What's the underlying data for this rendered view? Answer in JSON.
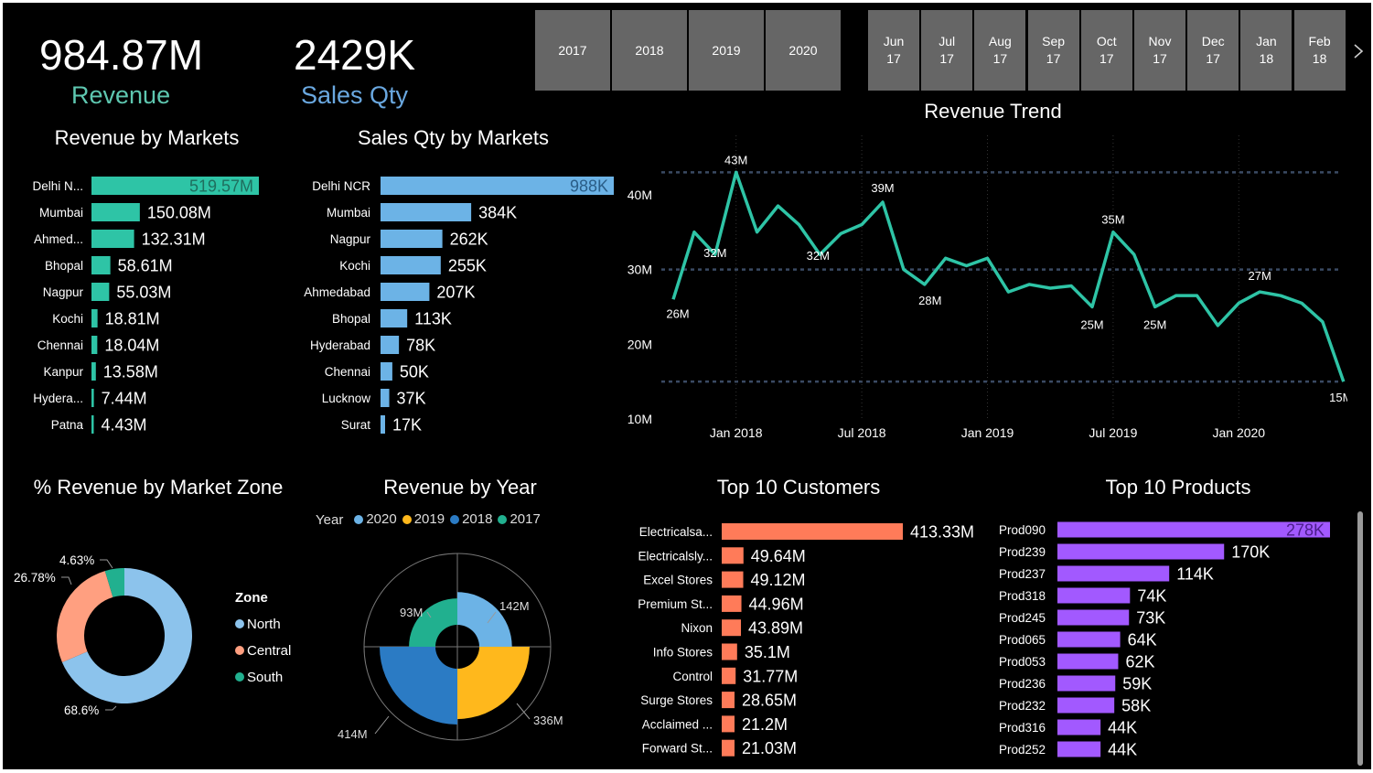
{
  "kpis": {
    "revenue": {
      "value": "984.87M",
      "label": "Revenue",
      "color": "#5ec7b0"
    },
    "sales_qty": {
      "value": "2429K",
      "label": "Sales Qty",
      "color": "#6aa8e0"
    }
  },
  "year_slicer": [
    "2017",
    "2018",
    "2019",
    "2020"
  ],
  "month_slicer": [
    {
      "m": "Jun",
      "y": "17"
    },
    {
      "m": "Jul",
      "y": "17"
    },
    {
      "m": "Aug",
      "y": "17"
    },
    {
      "m": "Sep",
      "y": "17"
    },
    {
      "m": "Oct",
      "y": "17"
    },
    {
      "m": "Nov",
      "y": "17"
    },
    {
      "m": "Dec",
      "y": "17"
    },
    {
      "m": "Jan",
      "y": "18"
    },
    {
      "m": "Feb",
      "y": "18"
    }
  ],
  "slicer_next_icon": "chevron-right-icon",
  "colors": {
    "teal": "#2ec4a6",
    "blue": "#6cb3e6",
    "salmon": "#ff7b59",
    "purple": "#a259ff",
    "yellow": "#ffb81c",
    "darkblue": "#2b7bc4",
    "lightblue": "#8cc3ec",
    "peach": "#ff9f80",
    "green": "#21b08f"
  },
  "chart_data": [
    {
      "id": "revenue_by_markets",
      "type": "bar",
      "orientation": "horizontal",
      "title": "Revenue by Markets",
      "categories": [
        "Delhi N...",
        "Mumbai",
        "Ahmed...",
        "Bhopal",
        "Nagpur",
        "Kochi",
        "Chennai",
        "Kanpur",
        "Hydera...",
        "Patna"
      ],
      "values": [
        519.57,
        150.08,
        132.31,
        58.61,
        55.03,
        18.81,
        18.04,
        13.58,
        7.44,
        4.43
      ],
      "labels": [
        "519.57M",
        "150.08M",
        "132.31M",
        "58.61M",
        "55.03M",
        "18.81M",
        "18.04M",
        "13.58M",
        "7.44M",
        "4.43M"
      ]
    },
    {
      "id": "sales_qty_by_markets",
      "type": "bar",
      "orientation": "horizontal",
      "title": "Sales Qty by Markets",
      "categories": [
        "Delhi NCR",
        "Mumbai",
        "Nagpur",
        "Kochi",
        "Ahmedabad",
        "Bhopal",
        "Hyderabad",
        "Chennai",
        "Lucknow",
        "Surat"
      ],
      "values": [
        988,
        384,
        262,
        255,
        207,
        113,
        78,
        50,
        37,
        17
      ],
      "labels": [
        "988K",
        "384K",
        "262K",
        "255K",
        "207K",
        "113K",
        "78K",
        "50K",
        "37K",
        "17K"
      ]
    },
    {
      "id": "revenue_trend",
      "type": "line",
      "title": "Revenue Trend",
      "ylim": [
        10,
        45
      ],
      "yticks": [
        "10M",
        "20M",
        "30M",
        "40M"
      ],
      "xticks": [
        "Jan 2018",
        "Jul 2018",
        "Jan 2019",
        "Jul 2019",
        "Jan 2020"
      ],
      "x": [
        "2017-10",
        "2017-11",
        "2017-12",
        "2018-01",
        "2018-02",
        "2018-03",
        "2018-04",
        "2018-05",
        "2018-06",
        "2018-07",
        "2018-08",
        "2018-09",
        "2018-10",
        "2018-11",
        "2018-12",
        "2019-01",
        "2019-02",
        "2019-03",
        "2019-04",
        "2019-05",
        "2019-06",
        "2019-07",
        "2019-08",
        "2019-09",
        "2019-10",
        "2019-11",
        "2019-12",
        "2020-01",
        "2020-02",
        "2020-03",
        "2020-04",
        "2020-05",
        "2020-06"
      ],
      "values": [
        26,
        35,
        32,
        43,
        35,
        38.5,
        36,
        32,
        34.8,
        36,
        39,
        30,
        28,
        31.5,
        30.5,
        31.5,
        27,
        28,
        27.5,
        27.8,
        25,
        35,
        32,
        25,
        26.5,
        26.5,
        22.5,
        25.5,
        27,
        26.5,
        25.5,
        23,
        15
      ],
      "data_labels": [
        {
          "i": 0,
          "text": "26M"
        },
        {
          "i": 2,
          "text": "32M"
        },
        {
          "i": 3,
          "text": "43M"
        },
        {
          "i": 7,
          "text": "32M"
        },
        {
          "i": 10,
          "text": "39M"
        },
        {
          "i": 12,
          "text": "28M"
        },
        {
          "i": 20,
          "text": "25M"
        },
        {
          "i": 21,
          "text": "35M"
        },
        {
          "i": 23,
          "text": "25M"
        },
        {
          "i": 28,
          "text": "27M"
        },
        {
          "i": 32,
          "text": "15M"
        }
      ]
    },
    {
      "id": "revenue_by_zone",
      "type": "pie",
      "title": "% Revenue by Market Zone",
      "legend_title": "Zone",
      "slices": [
        {
          "name": "North",
          "value": 68.6,
          "label": "68.6%",
          "color": "#8cc3ec"
        },
        {
          "name": "Central",
          "value": 26.78,
          "label": "26.78%",
          "color": "#ff9f80"
        },
        {
          "name": "South",
          "value": 4.63,
          "label": "4.63%",
          "color": "#21b08f"
        }
      ]
    },
    {
      "id": "revenue_by_year",
      "type": "pie",
      "title": "Revenue by Year",
      "legend_title": "Year",
      "series": [
        {
          "name": "2020",
          "value": 142,
          "label": "142M",
          "color": "#6cb3e6"
        },
        {
          "name": "2019",
          "value": 336,
          "label": "336M",
          "color": "#ffb81c"
        },
        {
          "name": "2018",
          "value": 414,
          "label": "414M",
          "color": "#2b7bc4"
        },
        {
          "name": "2017",
          "value": 93,
          "label": "93M",
          "color": "#21b08f"
        }
      ]
    },
    {
      "id": "top_customers",
      "type": "bar",
      "orientation": "horizontal",
      "title": "Top 10 Customers",
      "categories": [
        "Electricalsa...",
        "Electricalsly...",
        "Excel Stores",
        "Premium St...",
        "Nixon",
        "Info Stores",
        "Control",
        "Surge Stores",
        "Acclaimed ...",
        "Forward St..."
      ],
      "values": [
        413.33,
        49.64,
        49.12,
        44.96,
        43.89,
        35.1,
        31.77,
        28.65,
        21.2,
        21.03
      ],
      "labels": [
        "413.33M",
        "49.64M",
        "49.12M",
        "44.96M",
        "43.89M",
        "35.1M",
        "31.77M",
        "28.65M",
        "21.2M",
        "21.03M"
      ]
    },
    {
      "id": "top_products",
      "type": "bar",
      "orientation": "horizontal",
      "title": "Top 10 Products",
      "categories": [
        "Prod090",
        "Prod239",
        "Prod237",
        "Prod318",
        "Prod245",
        "Prod065",
        "Prod053",
        "Prod236",
        "Prod232",
        "Prod316",
        "Prod252"
      ],
      "values": [
        278,
        170,
        114,
        74,
        73,
        64,
        62,
        59,
        58,
        44,
        44
      ],
      "labels": [
        "278K",
        "170K",
        "114K",
        "74K",
        "73K",
        "64K",
        "62K",
        "59K",
        "58K",
        "44K",
        "44K"
      ]
    }
  ]
}
